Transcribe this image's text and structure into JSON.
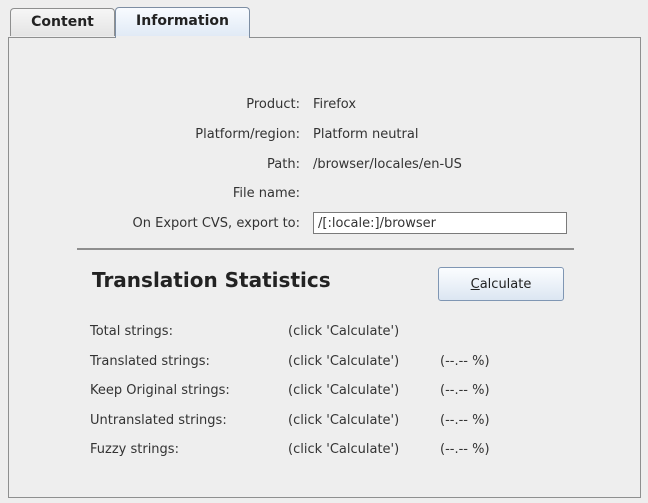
{
  "tabs": [
    {
      "label": "Content",
      "selected": false
    },
    {
      "label": "Information",
      "selected": true
    }
  ],
  "info": {
    "product_label": "Product:",
    "product_value": "Firefox",
    "platform_label": "Platform/region:",
    "platform_value": "Platform neutral",
    "path_label": "Path:",
    "path_value": "/browser/locales/en-US",
    "filename_label": "File name:",
    "filename_value": "",
    "export_label": "On Export CVS, export to:",
    "export_value": "/[:locale:]/browser"
  },
  "statistics": {
    "title": "Translation Statistics",
    "calculate_label": "Calculate",
    "calculate_mnemonic": "C",
    "calculate_rest": "alculate",
    "rows": [
      {
        "label": "Total strings:",
        "value": "(click 'Calculate')",
        "percent": ""
      },
      {
        "label": "Translated strings:",
        "value": "(click 'Calculate')",
        "percent": "(--.-- %)"
      },
      {
        "label": "Keep Original strings:",
        "value": "(click 'Calculate')",
        "percent": "(--.-- %)"
      },
      {
        "label": "Untranslated strings:",
        "value": "(click 'Calculate')",
        "percent": "(--.-- %)"
      },
      {
        "label": "Fuzzy strings:",
        "value": "(click 'Calculate')",
        "percent": "(--.-- %)"
      }
    ]
  },
  "colors": {
    "background": "#eeeeee",
    "selected_tab": "#dfe9f5",
    "button_border": "#7f96b3"
  }
}
